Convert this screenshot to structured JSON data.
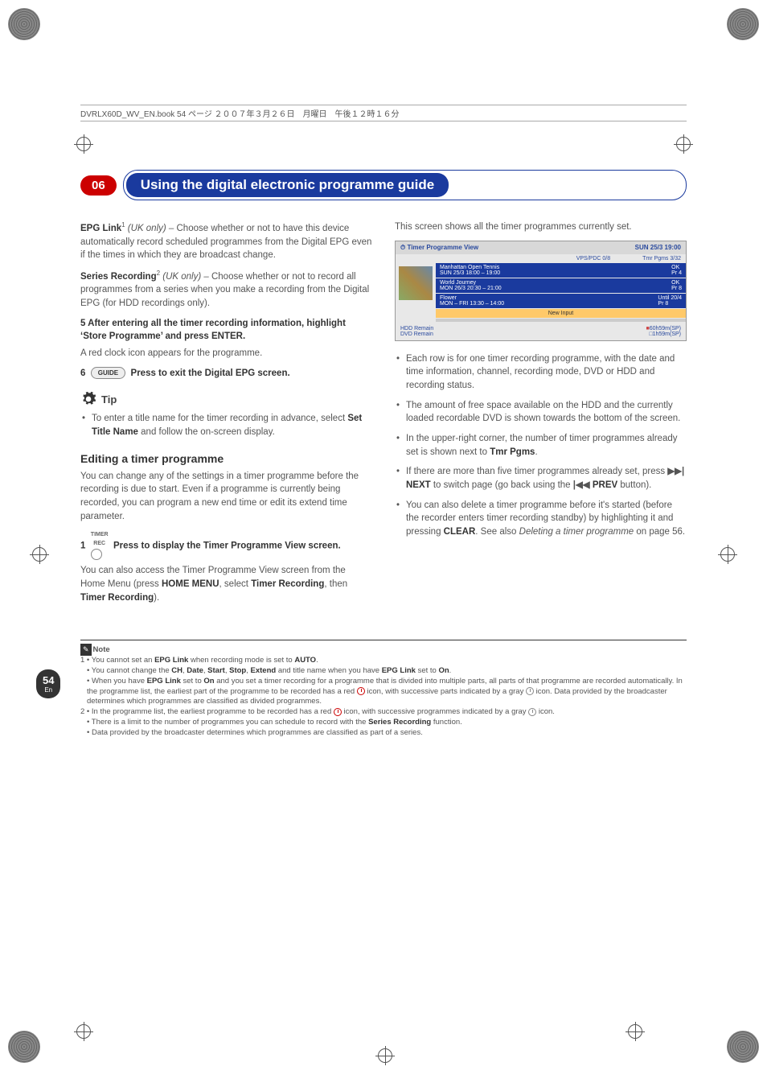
{
  "header_line": "DVRLX60D_WV_EN.book  54 ページ  ２００７年３月２６日　月曜日　午後１２時１６分",
  "chapter_num": "06",
  "chapter_title": "Using the digital electronic programme guide",
  "left": {
    "epg_link": "EPG Link",
    "epg_link_sup": "1",
    "epg_link_it": " (UK only) – ",
    "epg_link_txt": "Choose whether or not to have this device automatically record scheduled programmes from the Digital EPG even if the times in which they are broadcast change.",
    "series": "Series Recording",
    "series_sup": "2",
    "series_it": " (UK only) – ",
    "series_txt": "Choose whether or not to record all programmes from a series when you make a recording from the Digital EPG (for HDD recordings only).",
    "step5a": "5    After entering all the timer recording information, highlight ‘Store Programme’ and press ENTER.",
    "step5b": "A red clock icon appears for the programme.",
    "step6_num": "6",
    "step6_btn": "GUIDE",
    "step6_txt": "Press to exit the Digital EPG screen.",
    "tip_label": "Tip",
    "tip_txt_a": "To enter a title name for the timer recording in advance, select ",
    "tip_txt_b": "Set Title Name",
    "tip_txt_c": " and follow the on-screen display.",
    "edit_h": "Editing a timer programme",
    "edit_p": "You can change any of the settings in a timer programme before the recording is due to start. Even if a programme is currently being recorded, you can program a new end time or edit its extend time parameter.",
    "step1_num": "1",
    "step1_tiny1": "TIMER",
    "step1_tiny2": "REC",
    "step1_txt": "Press to display the Timer Programme View screen.",
    "step1_p_a": "You can also access the Timer Programme View screen from the Home Menu (press ",
    "step1_p_b": "HOME MENU",
    "step1_p_c": ", select ",
    "step1_p_d": "Timer Recording",
    "step1_p_e": ", then ",
    "step1_p_f": "Timer Recording",
    "step1_p_g": ")."
  },
  "right": {
    "intro": "This screen shows all the timer programmes currently set.",
    "b1": "Each row is for one timer recording programme, with the date and time information, channel, recording mode, DVD or HDD and recording status.",
    "b2": "The amount of free space available on the HDD and the currently loaded recordable DVD is shown towards the bottom of the screen.",
    "b3a": "In the upper-right corner, the number of timer programmes already set is shown next to ",
    "b3b": "Tmr Pgms",
    "b3c": ".",
    "b4a": "If there are more than five timer programmes already set, press ",
    "b4_next": "NEXT",
    "b4b": " to switch page (go back using the ",
    "b4_prev": "PREV",
    "b4c": " button).",
    "b5a": "You can also delete a timer programme before it's started (before the recorder enters timer recording standby) by highlighting it and pressing ",
    "b5_clear": "CLEAR",
    "b5b": ". See also ",
    "b5_it": "Deleting a timer programme",
    "b5c": " on page 56."
  },
  "tv": {
    "title": "Timer Programme View",
    "date": "SUN 25/3  19:00",
    "vps": "VPS/PDC 0/8",
    "tmr": "Tmr Pgms  3/32",
    "r1a": "Manhattan Open Tennis",
    "r1b": "OK",
    "r1c": "SUN 25/3    18:00 – 19:00",
    "r1d": "Pr 4",
    "r2a": "World Journey",
    "r2b": "OK",
    "r2c": "MON 26/3    20:30 – 21:00",
    "r2d": "Pr 8",
    "r3a": "Flower",
    "r3b": "Until 20/4",
    "r3c": "MON – FRI  13:30 – 14:00",
    "r3d": "Pr 8",
    "new": "New Input",
    "hdd": "HDD Remain",
    "hddv": "60h59m(SP)",
    "dvd": "DVD Remain",
    "dvdv": "1h59m(SP)"
  },
  "note": {
    "label": "Note",
    "n1a": "1 • You cannot set an ",
    "n1b": "EPG Link",
    "n1c": " when recording mode is set to ",
    "n1d": "AUTO",
    "n1e": ".",
    "n2a": "• You cannot change the ",
    "n2b": "CH",
    "n2c": ", ",
    "n2d": "Date",
    "n2e": ", ",
    "n2f": "Start",
    "n2g": ", ",
    "n2h": "Stop",
    "n2i": ", ",
    "n2j": "Extend",
    "n2k": " and title name when you have ",
    "n2l": "EPG Link",
    "n2m": " set to ",
    "n2n": "On",
    "n2o": ".",
    "n3a": "• When you have ",
    "n3b": "EPG Link",
    "n3c": " set to ",
    "n3d": "On",
    "n3e": " and you set a timer recording for a programme that is divided into multiple parts, all parts of that programme are recorded automatically. In the programme list, the earliest part of the programme to be recorded has a red ",
    "n3f": " icon, with successive parts indicated by a gray ",
    "n3g": " icon. Data provided by the broadcaster determines which programmes are classified as divided programmes.",
    "n4a": "2 • In the programme list, the earliest programme to be recorded has a red ",
    "n4b": " icon, with successive programmes indicated by a gray ",
    "n4c": " icon.",
    "n5a": "• There is a limit to the number of programmes you can schedule to record with the ",
    "n5b": "Series Recording",
    "n5c": " function.",
    "n6": "• Data provided by the broadcaster determines which programmes are classified as part of a series."
  },
  "page_num": "54",
  "page_lang": "En"
}
